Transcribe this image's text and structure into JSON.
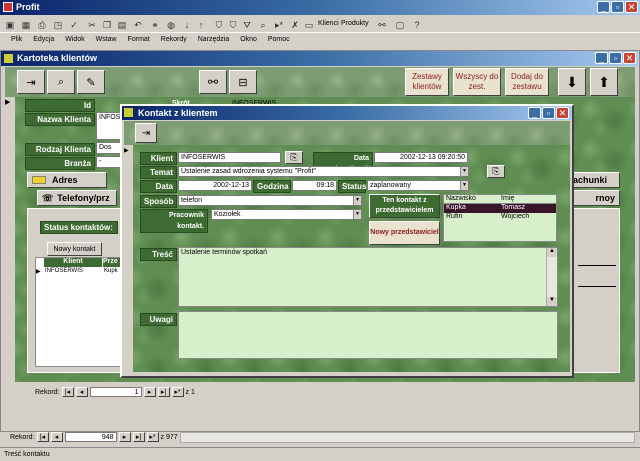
{
  "app": {
    "title": "Profit"
  },
  "menu": [
    "Plik",
    "Edycja",
    "Widok",
    "Wstaw",
    "Format",
    "Rekordy",
    "Narzędzia",
    "Okno",
    "Pomoc"
  ],
  "toolbar": {
    "klienci": "Klienci",
    "produkty": "Produkty"
  },
  "kartoteka": {
    "title": "Kartoteka klientów",
    "buttons": {
      "zestawy": "Zestawy klientów",
      "wszyscy": "Wszyscy do zest.",
      "dodaj": "Dodaj do zestawu"
    },
    "labels": {
      "id": "Id",
      "nazwa": "Nazwa Klienta",
      "rodzaj": "Rodzaj Klienta",
      "branza": "Branża",
      "status": "Status kontaktów:"
    },
    "values": {
      "nazwa": "INFOS",
      "rodzaj": "Dos",
      "branza": "-",
      "skrot": "Skrót",
      "clipped_name": "INFOSERWIS"
    },
    "tabs": {
      "adres": "Adres",
      "telefony": "Telefony/prz",
      "rachunki": "achunki",
      "inne": "rnoy"
    },
    "subtable": {
      "new_btn": "Nowy kontakt",
      "col1": "Klient",
      "col2": "Prze",
      "row_klient": "INFOSERWIS",
      "row_prze": "Kupk"
    },
    "inner_nav": {
      "label": "Rekord:",
      "value": "1",
      "of": "z 1"
    }
  },
  "footer_nav": {
    "label": "Rekord:",
    "value": "948",
    "of": "z 977"
  },
  "status_bar": "Treść kontaktu",
  "dialog": {
    "title": "Kontakt z klientem",
    "labels": {
      "klient": "Klient",
      "temat": "Temat",
      "data": "Data",
      "godzina": "Godzina",
      "status": "Status",
      "sposob": "Sposób",
      "pracownik": "Pracownik kontakt.",
      "tresc": "Treść",
      "uwagi": "Uwagi",
      "data_akt": "Data aktualizacji"
    },
    "values": {
      "klient": "INFOSERWIS",
      "temat": "Ustalenie zasad wdrożenia systemu \"Profit\"",
      "data": "2002-12-13",
      "godzina": "09:18",
      "status": "zaplanowany",
      "sposob": "telefon",
      "pracownik": "Koziołek",
      "tresc": "Ustalenie terminów spotkań",
      "uwagi": "",
      "data_akt": "2002-12-13 09:20:50"
    },
    "buttons": {
      "ten_kontakt": "Ten kontakt z przedstawicielem",
      "nowy": "Nowy przedstawiciel"
    },
    "rep_table": {
      "headers": [
        "Nazwisko",
        "Imię"
      ],
      "rows": [
        [
          "Kupka",
          "Tomasz"
        ],
        [
          "Rufin",
          "Wojciech"
        ]
      ]
    }
  }
}
